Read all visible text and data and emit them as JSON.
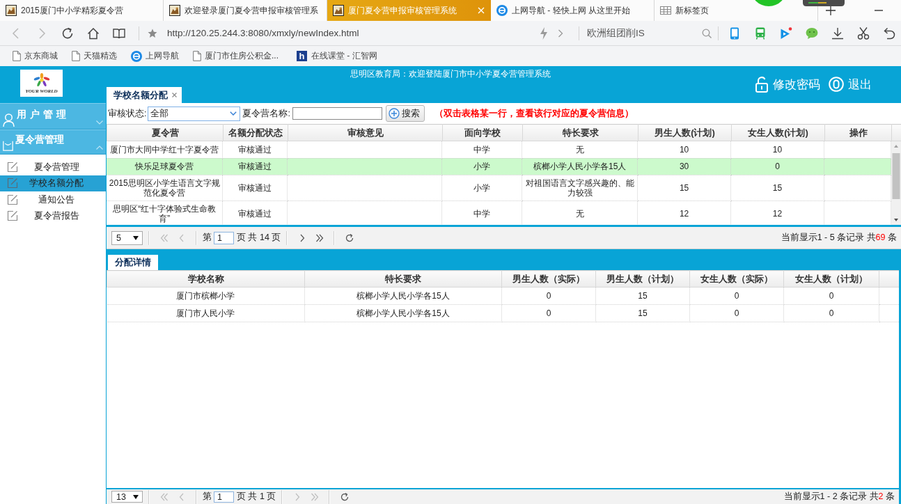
{
  "browser": {
    "tabs": [
      {
        "title": "2015厦门中小学精彩夏令营",
        "kind": "site",
        "selected": false
      },
      {
        "title": "欢迎登录厦门夏令营申报审核管理系",
        "kind": "site",
        "selected": false
      },
      {
        "title": "厦门夏令营申报审核管理系统",
        "kind": "site",
        "selected": true
      },
      {
        "title": "上网导航 - 轻快上网 从这里开始",
        "kind": "navigator",
        "selected": false
      },
      {
        "title": "新标签页",
        "kind": "blank",
        "selected": false
      }
    ],
    "url": "http://120.25.244.3:8080/xmxly/newIndex.html",
    "search_value": "欧洲组团削IS",
    "bookmarks": [
      {
        "label": "京东商城",
        "kind": "page"
      },
      {
        "label": "天猫精选",
        "kind": "page"
      },
      {
        "label": "上网导航",
        "kind": "navigator"
      },
      {
        "label": "厦门市住房公积金...",
        "kind": "page"
      },
      {
        "label": "在线课堂 - 汇智网",
        "kind": "letter",
        "badge": "h"
      }
    ]
  },
  "app": {
    "logo_text": "YOUR WORLD",
    "notice": "思明区教育局：欢迎登陆厦门市中小学夏令营管理系统",
    "header_links": [
      {
        "label": "修改密码",
        "kind": "lock"
      },
      {
        "label": "退出",
        "kind": "power"
      }
    ],
    "page_tabs": [
      {
        "label": "学校名额分配",
        "selected": true
      }
    ],
    "sidebar": {
      "sections": [
        {
          "title": "用户管理",
          "kind": "user",
          "expanded": false
        },
        {
          "title": "夏令营管理",
          "kind": "camp",
          "expanded": true,
          "items": [
            {
              "label": "夏令营管理",
              "selected": false
            },
            {
              "label": "学校名额分配",
              "selected": true
            },
            {
              "label": "通知公告",
              "selected": false
            },
            {
              "label": "夏令营报告",
              "selected": false
            }
          ]
        }
      ]
    },
    "filter": {
      "status_label": "审核状态:",
      "status_value": "全部",
      "name_label": "夏令营名称:",
      "search_button": "搜索",
      "hint": "（双击表格某一行，查看该行对应的夏令营信息）"
    },
    "camps_table": {
      "columns": [
        "夏令营",
        "名额分配状态",
        "审核意见",
        "面向学校",
        "特长要求",
        "男生人数(计划)",
        "女生人数(计划)",
        "操作"
      ],
      "rows": [
        {
          "camp": "厦门市大同中学红十字夏令营",
          "status": "审核通过",
          "school": "中学",
          "requirement": "无",
          "boys_planned": "10",
          "girls_planned": "10",
          "selected": false
        },
        {
          "camp": "快乐足球夏令营",
          "status": "审核通过",
          "school": "小学",
          "requirement": "槟榔小学人民小学各15人",
          "boys_planned": "30",
          "girls_planned": "0",
          "selected": true
        },
        {
          "camp": "2015思明区小学生语言文字规范化夏令营",
          "status": "审核通过",
          "school": "小学",
          "requirement": "对祖国语言文字感兴趣的、能力较强",
          "boys_planned": "15",
          "girls_planned": "15",
          "selected": false
        },
        {
          "camp": "思明区“红十字体验式生命教育”",
          "status": "审核通过",
          "school": "中学",
          "requirement": "无",
          "boys_planned": "12",
          "girls_planned": "12",
          "selected": false
        }
      ]
    },
    "camps_pager": {
      "page_size": "5",
      "nav_back": [
        {
          "kind": "first",
          "disabled": true
        },
        {
          "kind": "prev",
          "disabled": true
        }
      ],
      "page_prefix": "第",
      "page": "1",
      "page_suffix": "页 共 14 页",
      "nav_forward": [
        {
          "kind": "next",
          "disabled": false
        },
        {
          "kind": "last",
          "disabled": false
        }
      ],
      "summary": "当前显示1 - 5 条记录 共",
      "total": "69",
      "unit": "条"
    },
    "detail_tabs": [
      {
        "label": "分配详情",
        "selected": true
      }
    ],
    "detail_table": {
      "columns": [
        "学校名称",
        "特长要求",
        "男生人数（实际）",
        "男生人数（计划）",
        "女生人数（实际）",
        "女生人数（计划）"
      ],
      "rows": [
        {
          "school": "厦门市槟榔小学",
          "requirement": "槟榔小学人民小学各15人",
          "boys_actual": "0",
          "boys_planned": "15",
          "girls_actual": "0",
          "girls_planned": "0"
        },
        {
          "school": "厦门市人民小学",
          "requirement": "槟榔小学人民小学各15人",
          "boys_actual": "0",
          "boys_planned": "15",
          "girls_actual": "0",
          "girls_planned": "0"
        }
      ]
    },
    "detail_pager": {
      "page_size": "13",
      "nav_back": [
        {
          "kind": "first",
          "disabled": true
        },
        {
          "kind": "prev",
          "disabled": true
        }
      ],
      "page_prefix": "第",
      "page": "1",
      "page_suffix": "页 共 1 页",
      "nav_forward": [
        {
          "kind": "next",
          "disabled": true
        },
        {
          "kind": "last",
          "disabled": true
        }
      ],
      "summary": "当前显示1 - 2 条记录 共",
      "total": "2",
      "unit": "条"
    }
  }
}
